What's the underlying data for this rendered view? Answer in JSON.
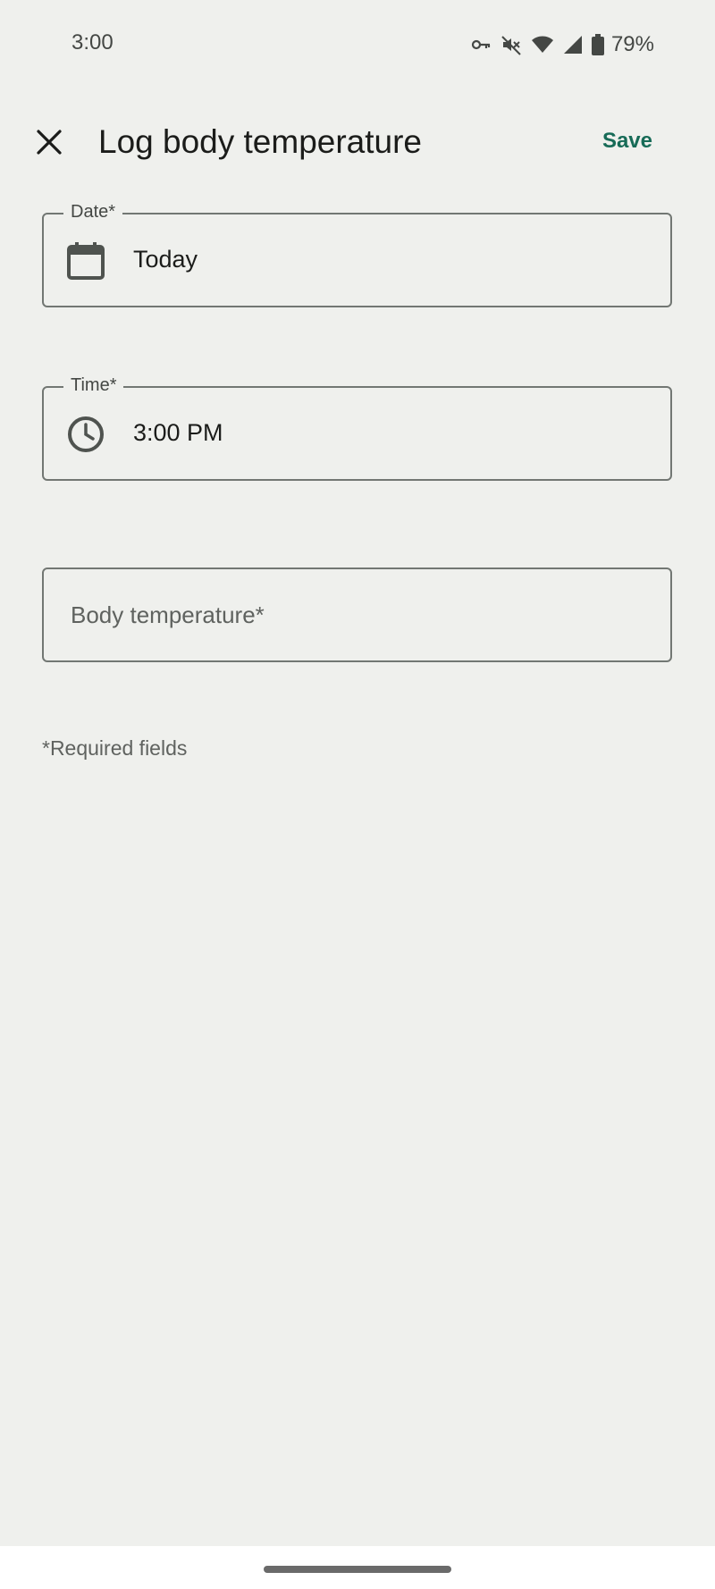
{
  "status_bar": {
    "time": "3:00",
    "icons": [
      "vpn-key-icon",
      "mute-icon",
      "wifi-icon",
      "cell-signal-icon",
      "battery-icon"
    ],
    "battery_percent": "79%"
  },
  "app_bar": {
    "close_icon": "close-icon",
    "title": "Log body temperature",
    "save_label": "Save"
  },
  "form": {
    "date": {
      "label": "Date*",
      "value": "Today",
      "icon": "calendar-icon"
    },
    "time": {
      "label": "Time*",
      "value": "3:00 PM",
      "icon": "clock-icon"
    },
    "body_temperature": {
      "placeholder": "Body temperature*",
      "value": ""
    },
    "required_note": "*Required fields"
  },
  "colors": {
    "background": "#eff0ed",
    "accent": "#176b57",
    "outline": "#727773",
    "text": "#1b1c1a"
  }
}
